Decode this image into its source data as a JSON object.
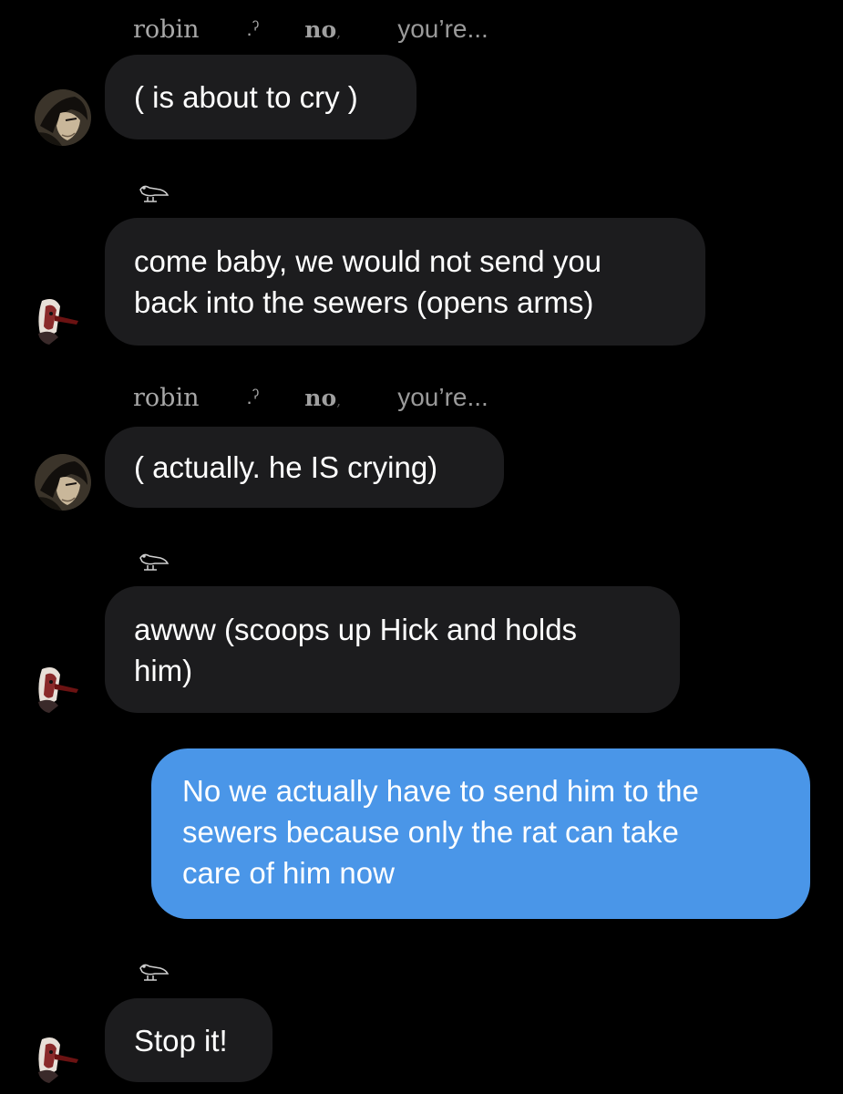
{
  "thread": {
    "headers": {
      "first": {
        "part1": "robin",
        "part2": ".ˀ",
        "part3": "no",
        "part3_tail": ",",
        "part4": "you’re..."
      },
      "second": {
        "part1": "robin",
        "part2": ".ˀ",
        "part3": "no",
        "part3_tail": ",",
        "part4": "you’re..."
      }
    },
    "messages": [
      {
        "text": "( is about to cry )"
      },
      {
        "text": "come baby, we would not send you\nback into the sewers (opens arms)"
      },
      {
        "text": "( actually. he IS crying)"
      },
      {
        "text": "awww (scoops up Hick and holds\nhim)"
      },
      {
        "text": "No we actually have to send him to the\nsewers because only the rat can take\ncare of him now"
      },
      {
        "text": "Stop it!"
      }
    ],
    "icons": {
      "sender_marker": "bird-icon",
      "avatar_a": "dark-portrait-avatar",
      "avatar_b": "red-black-character-avatar"
    },
    "colors": {
      "background": "#000000",
      "incoming_bubble": "#1c1c1e",
      "outgoing_bubble": "#4a96e8",
      "text": "#ffffff",
      "name_text": "#9a9a9a"
    }
  }
}
